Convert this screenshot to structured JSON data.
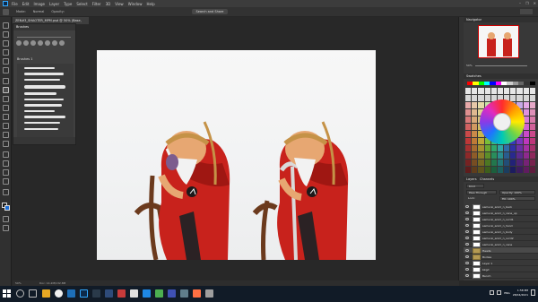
{
  "menu": [
    "File",
    "Edit",
    "Image",
    "Layer",
    "Type",
    "Select",
    "Filter",
    "3D",
    "View",
    "Window",
    "Help"
  ],
  "window_controls": [
    "–",
    "❐",
    "✕"
  ],
  "options": {
    "mode_label": "Mode:",
    "mode_value": "Normal",
    "opacity_label": "Opacity:",
    "search_label": "Search and Share"
  },
  "document_tab": "ZEN#3_SHAOTER_MPM.psd @ 50% (Base, RGB/8) *",
  "brushes": {
    "title": "Brushes",
    "folder": "Brushes 1"
  },
  "navigator": {
    "title": "Navigator",
    "zoom": "50%"
  },
  "swatches": {
    "title": "Swatches"
  },
  "layers": {
    "tabs": [
      "Layers",
      "Channels"
    ],
    "kind": "Kind",
    "blend": "Pass Through",
    "opacity": "Opacity: 100%",
    "fill": "Fill: 100%",
    "lock": "Lock:",
    "items": [
      {
        "name": "samurai_anim_n_back"
      },
      {
        "name": "samurai_anim_n_cane_up"
      },
      {
        "name": "samurai_anim_n_ovrd1"
      },
      {
        "name": "samurai_anim_n_hand"
      },
      {
        "name": "samurai_anim_n_body"
      },
      {
        "name": "samurai_anim_n_ovrd2"
      },
      {
        "name": "samurai_anim_n_cane"
      },
      {
        "name": "Heads",
        "group": true,
        "selected": true
      },
      {
        "name": "Bodies",
        "group": true
      },
      {
        "name": "Layer 1"
      },
      {
        "name": "bkgd"
      },
      {
        "name": "Bench"
      }
    ]
  },
  "status": {
    "zoom": "50%",
    "doc": "Doc: 14.2M/132.8M"
  },
  "taskbar": {
    "language": "ENG",
    "time": "1:58 PM",
    "date": "28/04/2021"
  }
}
